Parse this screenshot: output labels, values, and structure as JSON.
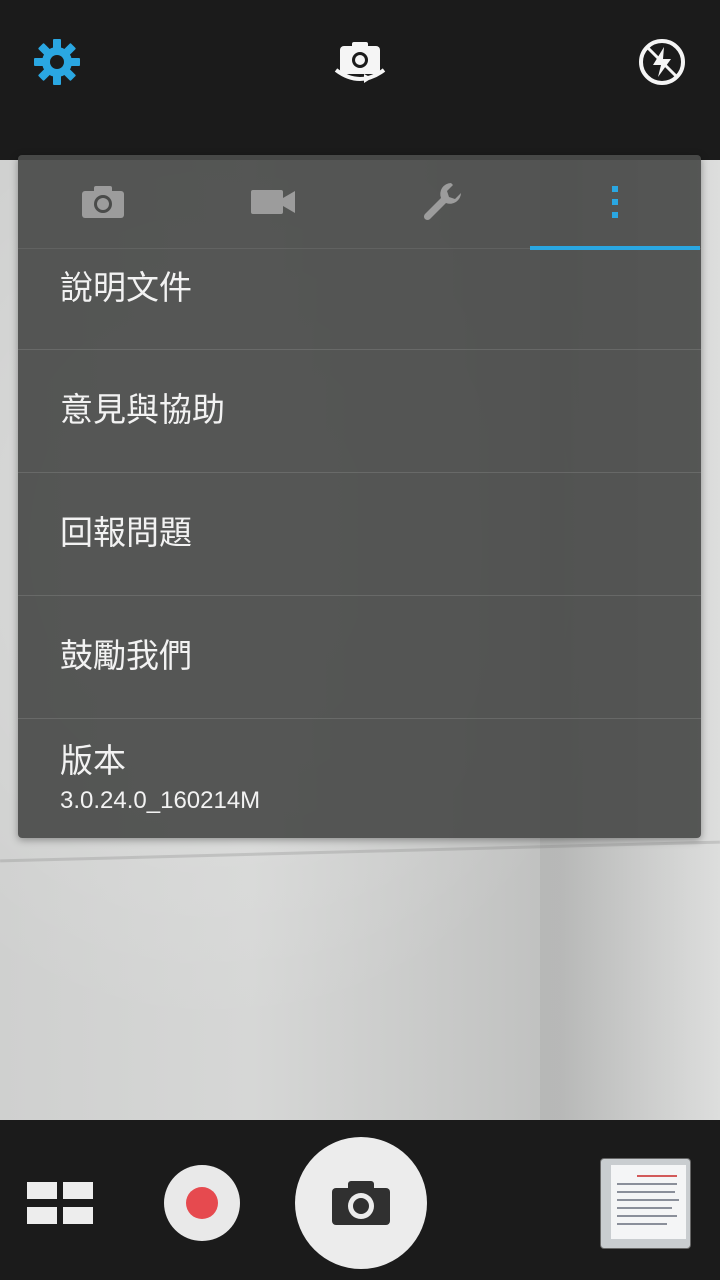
{
  "top_bar": {
    "icons": [
      "gear-icon",
      "switch-camera-icon",
      "flash-off-icon"
    ],
    "accent_color": "#2aa7e2"
  },
  "settings_panel": {
    "tabs": [
      {
        "icon": "camera-icon",
        "active": false
      },
      {
        "icon": "video-camera-icon",
        "active": false
      },
      {
        "icon": "wrench-icon",
        "active": false
      },
      {
        "icon": "more-vert-icon",
        "active": true
      }
    ],
    "menu": {
      "help": "說明文件",
      "feedback": "意見與協助",
      "report": "回報問題",
      "encourage": "鼓勵我們",
      "version_label": "版本",
      "version_value": "3.0.24.0_160214M"
    }
  },
  "bottom_bar": {
    "icons": [
      "grid-mode-icon",
      "record-icon",
      "shutter-icon",
      "gallery-thumbnail"
    ],
    "record_color": "#e64a4f"
  }
}
